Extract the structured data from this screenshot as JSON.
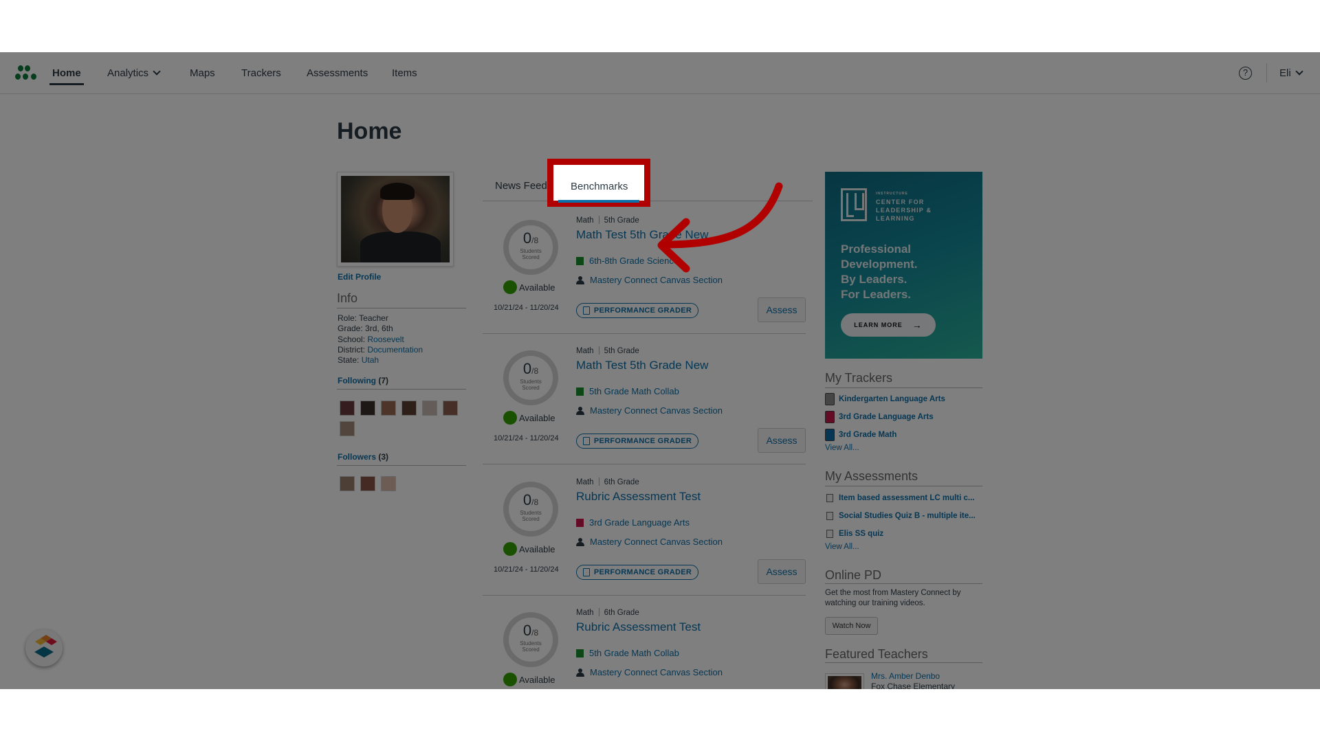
{
  "nav": {
    "items": [
      {
        "label": "Home",
        "active": true
      },
      {
        "label": "Analytics",
        "has_dropdown": true
      },
      {
        "label": "Maps"
      },
      {
        "label": "Trackers"
      },
      {
        "label": "Assessments"
      },
      {
        "label": "Items"
      }
    ],
    "help_icon": "question-circle-icon",
    "help_glyph": "?",
    "user_label": "Eli"
  },
  "page": {
    "title": "Home"
  },
  "profile": {
    "edit_label": "Edit Profile",
    "info_heading": "Info",
    "info": [
      {
        "label": "Role:",
        "value": "Teacher",
        "link": false
      },
      {
        "label": "Grade:",
        "value": "3rd, 6th",
        "link": false
      },
      {
        "label": "School:",
        "value": "Roosevelt",
        "link": true
      },
      {
        "label": "District:",
        "value": "Documentation",
        "link": true
      },
      {
        "label": "State:",
        "value": "Utah",
        "link": true
      }
    ],
    "following_label": "Following",
    "following_count": "(7)",
    "followers_label": "Followers",
    "followers_count": "(3)"
  },
  "tabs": [
    {
      "label": "News Feed",
      "active": false
    },
    {
      "label": "Benchmarks",
      "active": true
    }
  ],
  "benchmarks": [
    {
      "subject": "Math",
      "grade": "5th Grade",
      "title": "Math Test 5th Grade New",
      "tracker": "6th-8th Grade Science",
      "tracker_color": "#1a8c2e",
      "section": "Mastery Connect Canvas Section",
      "scored": "0",
      "total": "/8",
      "scored_label_1": "Students",
      "scored_label_2": "Scored",
      "status": "Available",
      "dates": "10/21/24 - 11/20/24",
      "grader_label": "PERFORMANCE GRADER",
      "assess_label": "Assess"
    },
    {
      "subject": "Math",
      "grade": "5th Grade",
      "title": "Math Test 5th Grade New",
      "tracker": "5th Grade Math Collab",
      "tracker_color": "#1a8c2e",
      "section": "Mastery Connect Canvas Section",
      "scored": "0",
      "total": "/8",
      "scored_label_1": "Students",
      "scored_label_2": "Scored",
      "status": "Available",
      "dates": "10/21/24 - 11/20/24",
      "grader_label": "PERFORMANCE GRADER",
      "assess_label": "Assess"
    },
    {
      "subject": "Math",
      "grade": "6th Grade",
      "title": "Rubric Assessment Test",
      "tracker": "3rd Grade Language Arts",
      "tracker_color": "#c8184a",
      "section": "Mastery Connect Canvas Section",
      "scored": "0",
      "total": "/8",
      "scored_label_1": "Students",
      "scored_label_2": "Scored",
      "status": "Available",
      "dates": "10/21/24 - 11/20/24",
      "grader_label": "PERFORMANCE GRADER",
      "assess_label": "Assess"
    },
    {
      "subject": "Math",
      "grade": "6th Grade",
      "title": "Rubric Assessment Test",
      "tracker": "5th Grade Math Collab",
      "tracker_color": "#1a8c2e",
      "section": "Mastery Connect Canvas Section",
      "scored": "0",
      "total": "/8",
      "scored_label_1": "Students",
      "scored_label_2": "Scored",
      "status": "Available",
      "dates": "",
      "grader_label": "",
      "assess_label": ""
    }
  ],
  "ad": {
    "brand_small": "INSTRUCTURE",
    "brand": "CENTER FOR LEADERSHIP & LEARNING",
    "headline_1": "Professional",
    "headline_2": "Development.",
    "headline_3": "By Leaders.",
    "headline_4": "For Leaders.",
    "cta": "LEARN MORE",
    "cta_arrow": "→"
  },
  "my_trackers": {
    "heading": "My Trackers",
    "items": [
      {
        "name": "Kindergarten Language Arts",
        "color": "#8a8a8a"
      },
      {
        "name": "3rd Grade Language Arts",
        "color": "#c8184a"
      },
      {
        "name": "3rd Grade Math",
        "color": "#0b6fa8"
      }
    ],
    "view_all": "View All..."
  },
  "my_assessments": {
    "heading": "My Assessments",
    "items": [
      {
        "name": "Item based assessment LC multi c..."
      },
      {
        "name": "Social Studies Quiz B - multiple ite..."
      },
      {
        "name": "Elis SS quiz"
      }
    ],
    "view_all": "View All..."
  },
  "online_pd": {
    "heading": "Online PD",
    "text": "Get the most from Mastery Connect by watching our training videos.",
    "button": "Watch Now"
  },
  "featured_teachers": {
    "heading": "Featured Teachers",
    "items": [
      {
        "name": "Mrs. Amber Denbo",
        "school": "Fox Chase Elementary"
      }
    ]
  },
  "annotation": {
    "highlight_color": "#b00000",
    "target": "Benchmarks"
  },
  "colors": {
    "link": "#0b6fa8",
    "text": "#2d3b45",
    "available": "#35a300",
    "brand_green": "#0d7a3a"
  }
}
